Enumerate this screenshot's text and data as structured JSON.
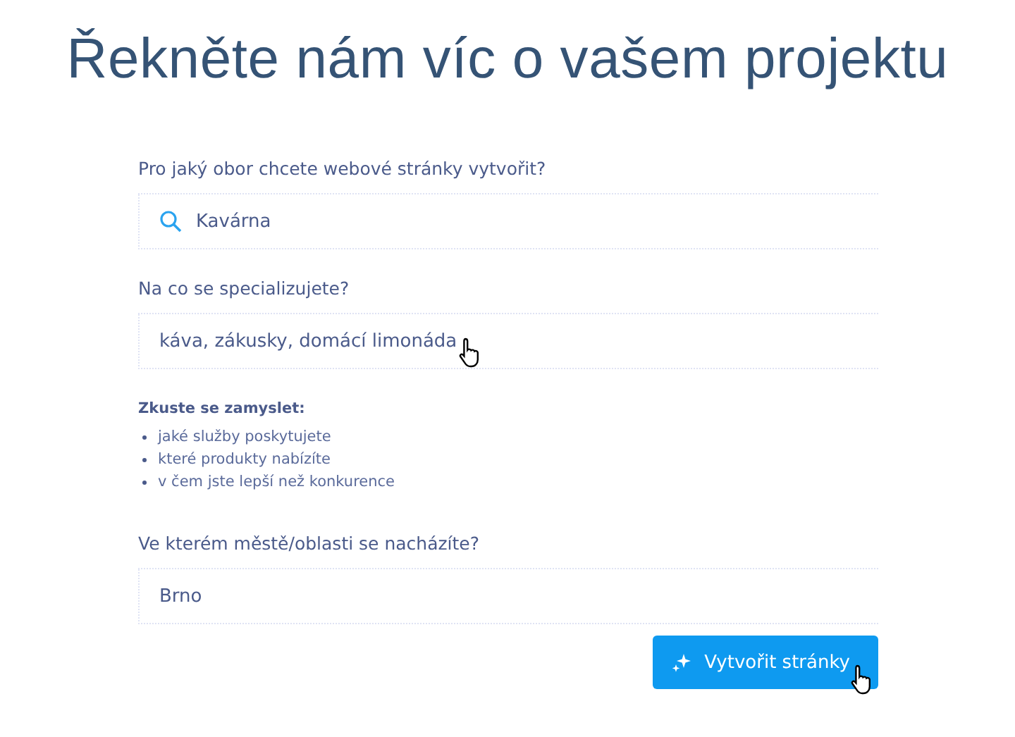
{
  "title": "Řekněte nám víc o vašem projektu",
  "questions": [
    {
      "label": "Pro jaký obor chcete webové stránky vytvořit?",
      "kind": "search",
      "value": "Kavárna",
      "cursor": false
    },
    {
      "label": "Na co se specializujete?",
      "kind": "text",
      "value": "káva, zákusky, domácí limonáda",
      "cursor": true,
      "hint": {
        "heading": "Zkuste se zamyslet:",
        "items": [
          "jaké služby poskytujete",
          "které produkty nabízíte",
          "v čem jste lepší než konkurence"
        ]
      }
    },
    {
      "label": "Ve kterém městě/oblasti se nacházíte?",
      "kind": "text",
      "value": "Brno",
      "cursor": false
    }
  ],
  "submit": {
    "label": "Vytvořit stránky",
    "cursor": true
  }
}
